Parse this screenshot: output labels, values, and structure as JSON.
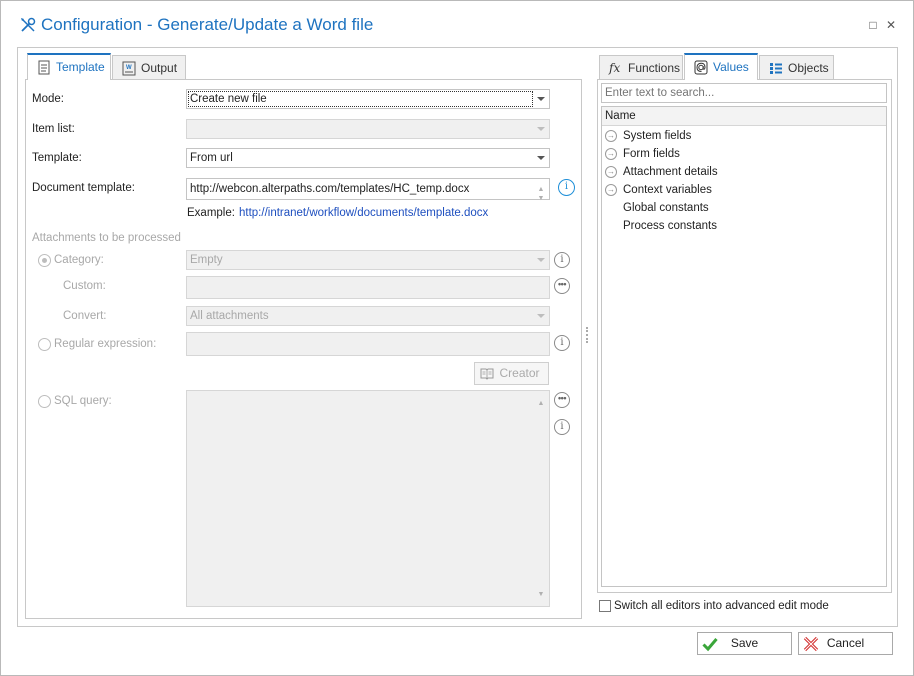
{
  "window": {
    "title": "Configuration - Generate/Update a Word file",
    "maximize_glyph": "□",
    "close_glyph": "✕"
  },
  "left_tabs": [
    {
      "label": "Template",
      "icon": "document-icon"
    },
    {
      "label": "Output",
      "icon": "word-file-icon"
    }
  ],
  "form": {
    "mode_label": "Mode:",
    "mode_value": "Create new file",
    "item_list_label": "Item list:",
    "item_list_value": "",
    "template_label": "Template:",
    "template_value": "From url",
    "doc_template_label": "Document template:",
    "doc_template_value": "http://webcon.alterpaths.com/templates/HC_temp.docx",
    "example_label": "Example:",
    "example_value": "http://intranet/workflow/documents/template.docx",
    "attachments_header": "Attachments to be processed",
    "category_label": "Category:",
    "category_value": "Empty",
    "custom_label": "Custom:",
    "custom_value": "",
    "convert_label": "Convert:",
    "convert_value": "All attachments",
    "regex_label": "Regular expression:",
    "regex_value": "",
    "creator_label": "Creator",
    "sql_label": "SQL query:",
    "sql_value": ""
  },
  "right_tabs": [
    {
      "label": "Functions",
      "icon": "fx-icon"
    },
    {
      "label": "Values",
      "icon": "at-sign-icon"
    },
    {
      "label": "Objects",
      "icon": "list-icon"
    }
  ],
  "right_panel": {
    "search_placeholder": "Enter text to search...",
    "column_header": "Name",
    "items": [
      {
        "label": "System fields",
        "expandable": true
      },
      {
        "label": "Form fields",
        "expandable": true
      },
      {
        "label": "Attachment details",
        "expandable": true
      },
      {
        "label": "Context variables",
        "expandable": true
      },
      {
        "label": "Global constants",
        "expandable": false
      },
      {
        "label": "Process constants",
        "expandable": false
      }
    ],
    "advanced_mode_label": "Switch all editors into advanced edit mode"
  },
  "footer": {
    "save_label": "Save",
    "cancel_label": "Cancel"
  },
  "colors": {
    "accent": "#1e73c0",
    "link": "#1e4fbf",
    "save_icon": "#3aa63a",
    "cancel_icon": "#d33030"
  }
}
